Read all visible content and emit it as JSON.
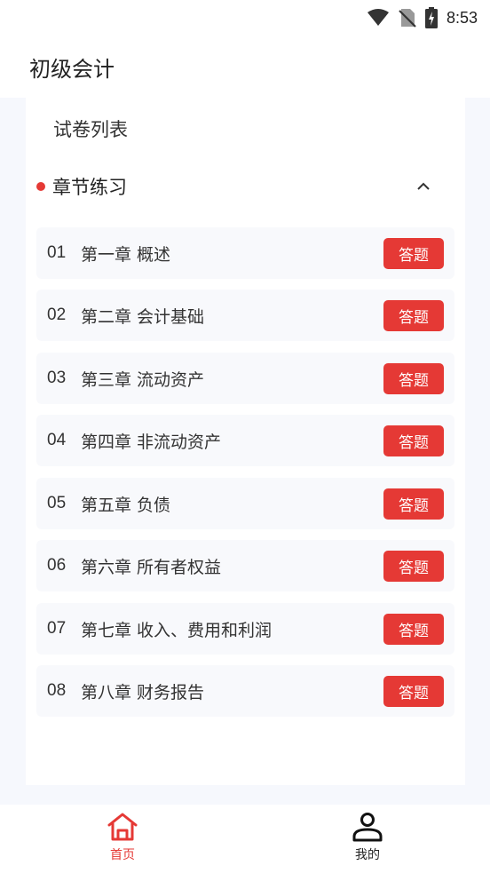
{
  "status_bar": {
    "time": "8:53"
  },
  "header": {
    "title": "初级会计"
  },
  "card": {
    "section_title": "试卷列表",
    "chapter_group": {
      "label": "章节练习",
      "accent": "#e53935",
      "expanded": true
    },
    "items": [
      {
        "num": "01",
        "name": "第一章 概述",
        "action": "答题"
      },
      {
        "num": "02",
        "name": "第二章 会计基础",
        "action": "答题"
      },
      {
        "num": "03",
        "name": "第三章 流动资产",
        "action": "答题"
      },
      {
        "num": "04",
        "name": "第四章 非流动资产",
        "action": "答题"
      },
      {
        "num": "05",
        "name": "第五章 负债",
        "action": "答题"
      },
      {
        "num": "06",
        "name": "第六章 所有者权益",
        "action": "答题"
      },
      {
        "num": "07",
        "name": "第七章 收入、费用和利润",
        "action": "答题"
      },
      {
        "num": "08",
        "name": "第八章 财务报告",
        "action": "答题"
      }
    ]
  },
  "tabbar": {
    "active_color": "#e53935",
    "tabs": [
      {
        "label": "首页",
        "icon": "home-icon",
        "active": true
      },
      {
        "label": "我的",
        "icon": "person-icon",
        "active": false
      }
    ]
  }
}
